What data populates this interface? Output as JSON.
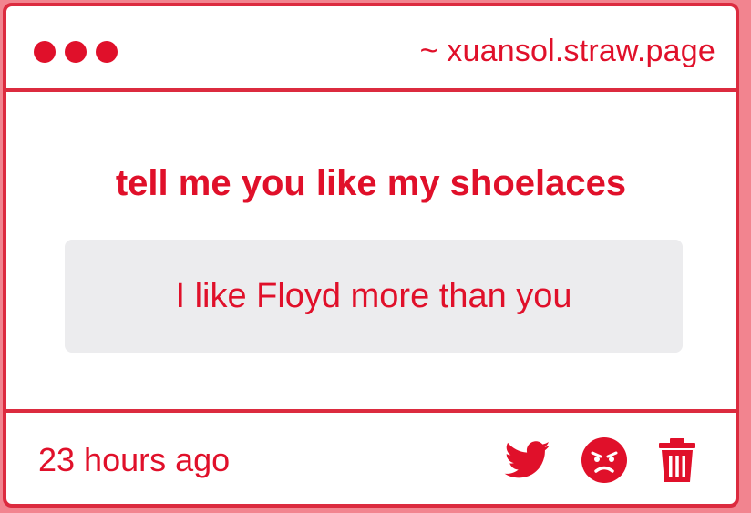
{
  "header": {
    "site_label": "~ xuansol.straw.page"
  },
  "message": {
    "question": "tell me you like my shoelaces",
    "answer": "I like Floyd more than you"
  },
  "footer": {
    "timestamp": "23 hours ago",
    "actions": [
      "twitter-share",
      "angry-reaction",
      "delete"
    ]
  },
  "colors": {
    "accent": "#e0102a",
    "border": "#dc2b3f",
    "answer_bg": "#ececee",
    "page_bg": "#f2848f"
  }
}
